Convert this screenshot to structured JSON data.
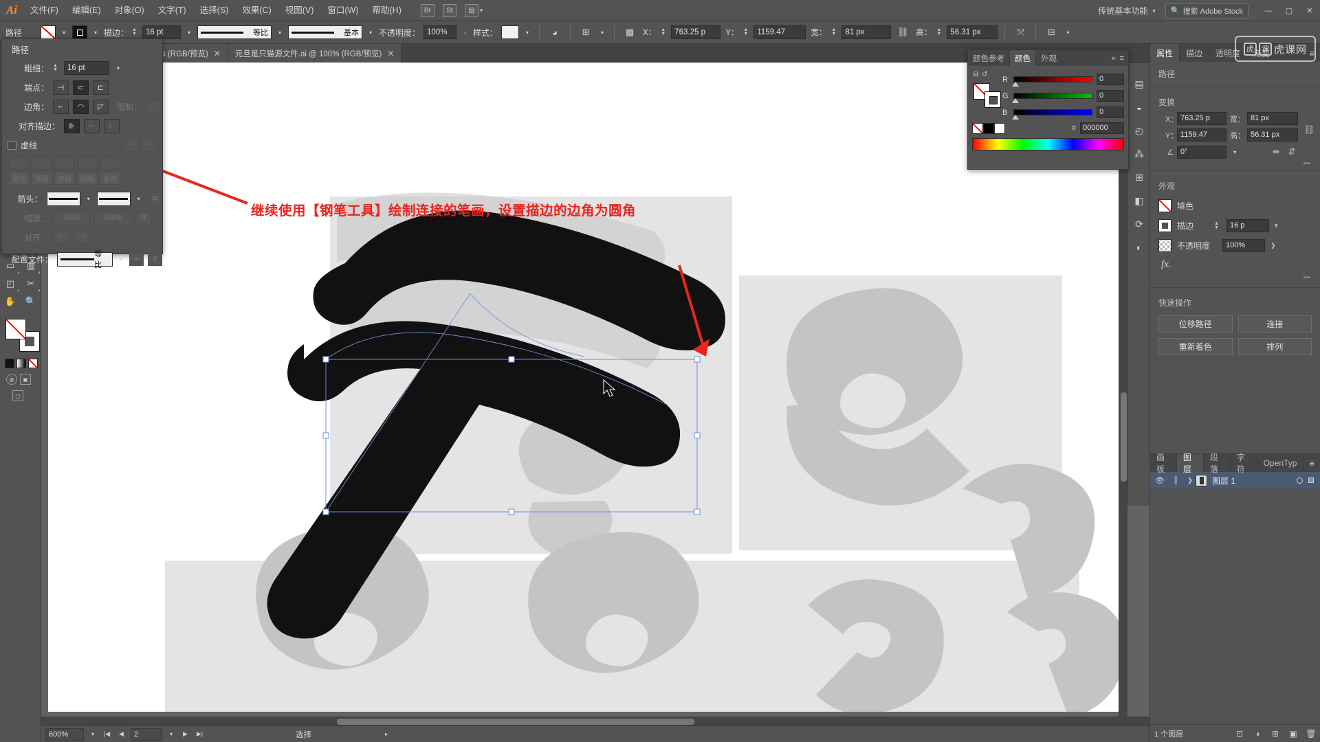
{
  "app": {
    "logo": "Ai"
  },
  "menubar": {
    "items": [
      "文件(F)",
      "编辑(E)",
      "对象(O)",
      "文字(T)",
      "选择(S)",
      "效果(C)",
      "视图(V)",
      "窗口(W)",
      "帮助(H)"
    ],
    "icons": [
      "bridge-icon",
      "stock-icon",
      "arrange-documents-icon"
    ],
    "workspace": "传统基本功能",
    "search_label": "搜索 Adobe Stock",
    "win_min": "—",
    "win_max": "▢",
    "win_close": "✕"
  },
  "watermark": {
    "text": "虎课网",
    "box1": "虎",
    "box2": "课"
  },
  "controlbar": {
    "path_label": "路径",
    "fill_swatch": "none-swatch",
    "stroke_swatch": "black-swatch",
    "stroke_label": "描边：",
    "stroke_weight": "16 pt",
    "profile_label": "等比",
    "brush_label": "基本",
    "opacity_label": "不透明度：",
    "opacity_value": "100%",
    "style_label": "样式：",
    "x_label": "X：",
    "x_value": "763.25 p",
    "y_label": "Y：",
    "y_value": "1159.47 ",
    "w_label": "宽：",
    "w_value": "81 px",
    "h_label": "高：",
    "h_value": "56.31 px",
    "transform_icon": "transform-icon",
    "align_icon": "align-icon",
    "opacity_arrow": "›"
  },
  "stroke_panel": {
    "title": "路径",
    "weight_label": "粗细：",
    "weight_value": "16 pt",
    "cap_label": "端点：",
    "corner_label": "边角：",
    "limit_label": "限制：",
    "limit_value": "",
    "align_label": "对齐描边：",
    "dash_label": "虚线",
    "dash_segments": [
      "虚线",
      "间隙",
      "虚线",
      "间隙",
      "虚线"
    ],
    "arrow_label": "箭头：",
    "scale_label": "缩放：",
    "scale_v1": "100%",
    "scale_v2": "100%",
    "align_row_label": "对齐：",
    "profile_label": "配置文件：",
    "profile_value": "等比"
  },
  "doctabs": [
    {
      "label": "s (RGB/预览)",
      "close": "✕",
      "active": false
    },
    {
      "label": "元旦是只猫源文件.ai @ 100% (RGB/预览)",
      "close": "✕",
      "active": true
    }
  ],
  "annotation": "继续使用【钢笔工具】绘制连接的笔画，设置描边的边角为圆角",
  "toolbar": {
    "tools": [
      "rectangle-tool",
      "column-graph-tool",
      "artboard-tool",
      "slice-tool",
      "hand-tool",
      "zoom-tool"
    ],
    "fill_label": "fill-stroke-indicator",
    "screen_modes": [
      "normal-screen-mode",
      "full-screen-mode"
    ]
  },
  "color_panel": {
    "tabs": [
      "颜色参考",
      "颜色",
      "外观"
    ],
    "active_tab": "颜色",
    "channels": [
      {
        "name": "R",
        "value": "0"
      },
      {
        "name": "G",
        "value": "0"
      },
      {
        "name": "B",
        "value": "0"
      }
    ],
    "hex_label": "#",
    "hex_value": "000000",
    "menu_icon": "panel-menu-icon",
    "collapse_icon": "»"
  },
  "properties": {
    "tabs": [
      "属性",
      "描边",
      "透明度",
      "渐变"
    ],
    "active_tab": "属性",
    "section_path": "路径",
    "section_transform": "变换",
    "transform": {
      "x_label": "X：",
      "x_value": "763.25 p",
      "y_label": "Y：",
      "y_value": "1159.47",
      "w_label": "宽：",
      "w_value": "81 px",
      "h_label": "高：",
      "h_value": "56.31 px",
      "angle_label": "angle-icon",
      "angle_value": "0°",
      "link_icon": "unlink-icon",
      "flip_h_icon": "flip-horizontal-icon",
      "flip_v_icon": "flip-vertical-icon",
      "more_icon": "•••"
    },
    "section_appearance": "外观",
    "appearance": {
      "fill_label": "填色",
      "stroke_label": "描边",
      "stroke_weight": "16 p",
      "opacity_label": "不透明度",
      "opacity_value": "100%",
      "fx_label": "fx.",
      "more_icon": "•••"
    },
    "section_quick": "快速操作",
    "quick_actions": [
      "位移路径",
      "连接",
      "重新着色",
      "排列"
    ]
  },
  "layers_panel": {
    "tabs": [
      "画板",
      "图层",
      "段落",
      "字符",
      "OpenTyp"
    ],
    "active_tab": "图层",
    "rows": [
      {
        "name": "图层 1",
        "eye": "eye-icon",
        "visible": true
      }
    ],
    "footer": {
      "count": "1 个图层"
    }
  },
  "statusbar": {
    "zoom": "600%",
    "page": "2",
    "tool": "选择",
    "nav_first": "|◀",
    "nav_prev": "◀",
    "nav_next": "▶",
    "nav_last": "▶|"
  },
  "colors": {
    "chrome": "#535353",
    "panel_dark": "#454545",
    "canvas": "#636363",
    "artboard": "#ffffff",
    "accent_red": "#e8251f",
    "selection_blue": "#6d8fd6",
    "layer_highlight": "#4a5a72",
    "artwork_black": "#111111",
    "artwork_gray": "#c4c4c4",
    "artwork_lightgray": "#e4e4e4"
  }
}
